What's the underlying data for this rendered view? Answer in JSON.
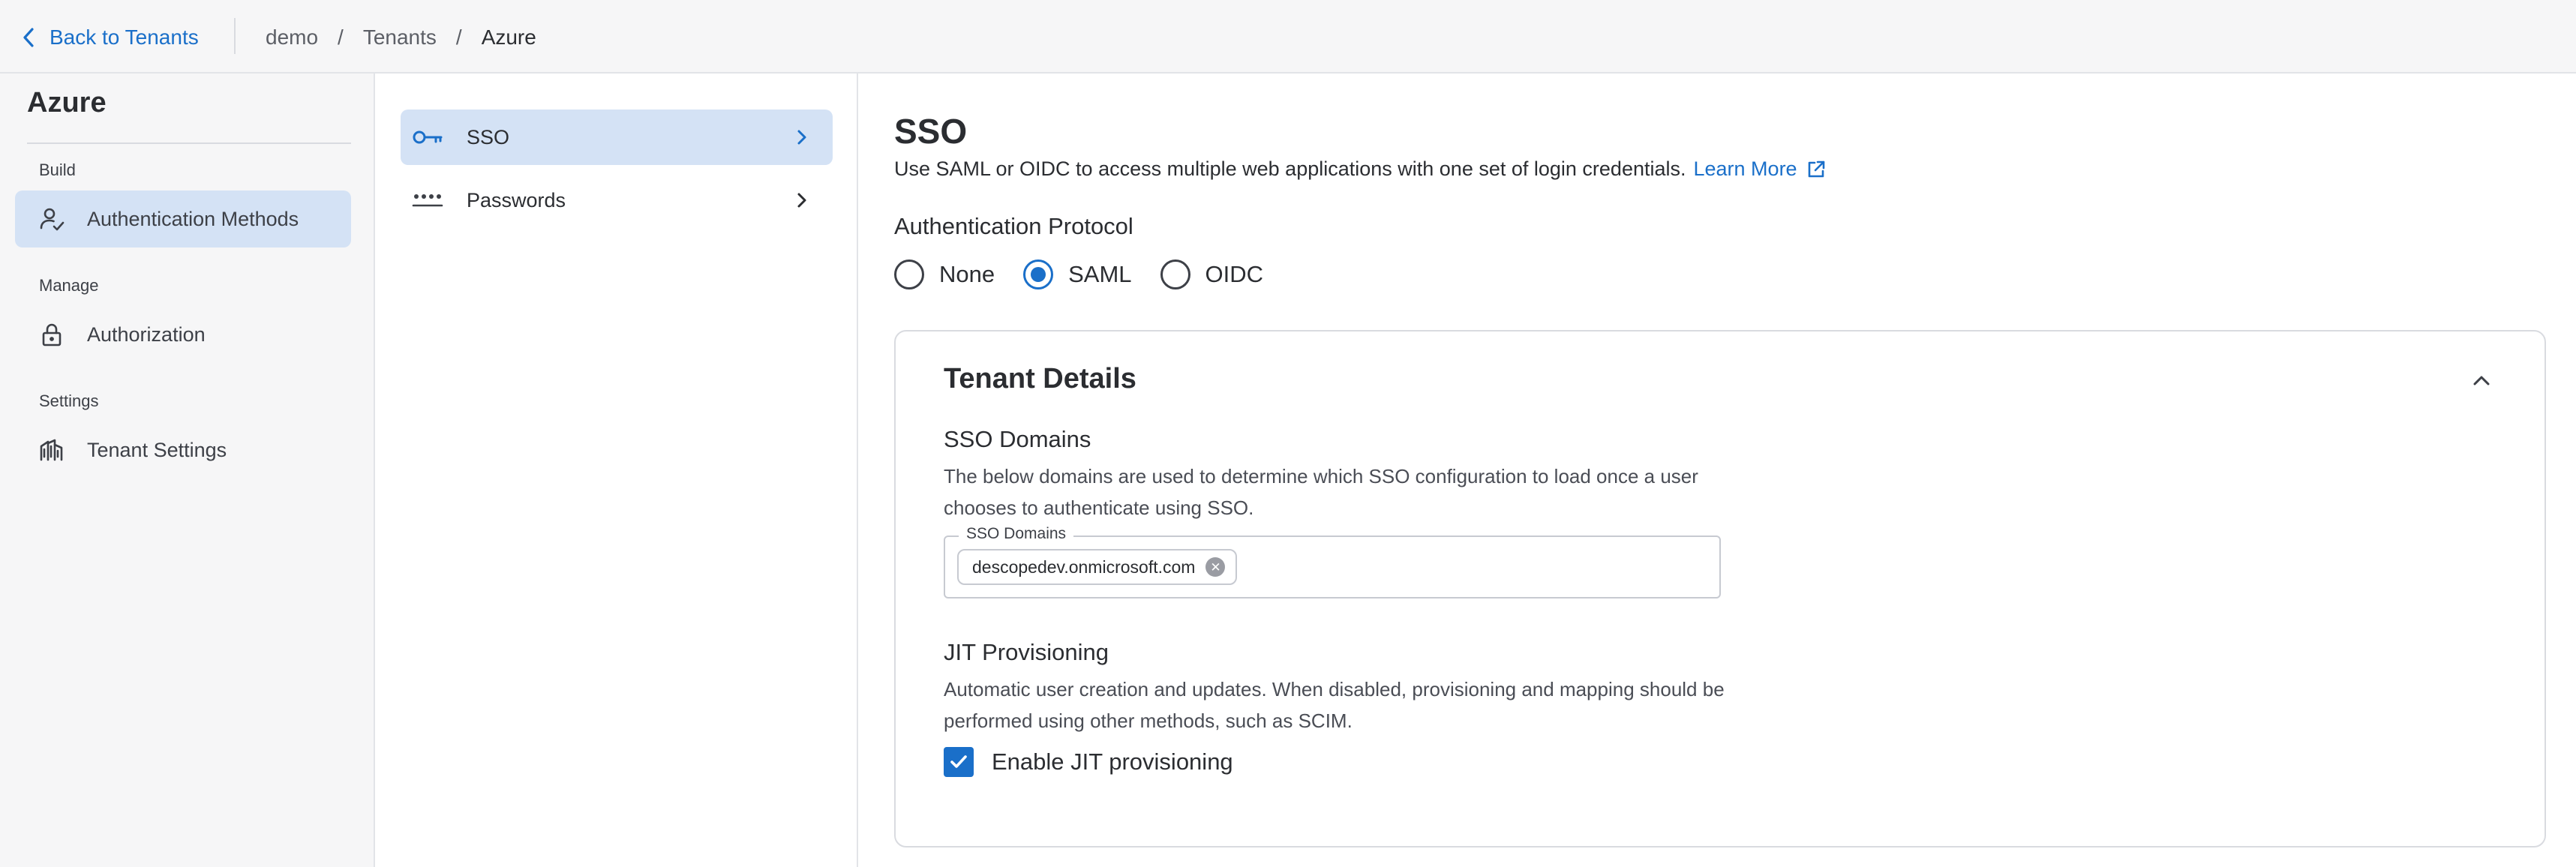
{
  "topbar": {
    "back_label": "Back to Tenants",
    "breadcrumb": [
      "demo",
      "Tenants",
      "Azure"
    ],
    "separator": "/"
  },
  "sidebar": {
    "tenant_name": "Azure",
    "sections": [
      {
        "label": "Build",
        "item": {
          "label": "Authentication Methods",
          "icon": "user-check-icon",
          "active": true
        }
      },
      {
        "label": "Manage",
        "item": {
          "label": "Authorization",
          "icon": "lock-icon",
          "active": false
        }
      },
      {
        "label": "Settings",
        "item": {
          "label": "Tenant Settings",
          "icon": "building-icon",
          "active": false
        }
      }
    ]
  },
  "methods": [
    {
      "label": "SSO",
      "icon": "key-icon",
      "active": true
    },
    {
      "label": "Passwords",
      "icon": "password-dots-icon",
      "active": false
    }
  ],
  "main": {
    "title": "SSO",
    "description": "Use SAML or OIDC to access multiple web applications with one set of login credentials.",
    "learn_more": "Learn More",
    "protocol_label": "Authentication Protocol",
    "protocol_options": [
      "None",
      "SAML",
      "OIDC"
    ],
    "protocol_selected": "SAML",
    "card": {
      "title": "Tenant Details",
      "sso_domains": {
        "title": "SSO Domains",
        "description": "The below domains are used to determine which SSO configuration to load once a user chooses to authenticate using SSO.",
        "field_label": "SSO Domains",
        "chips": [
          "descopedev.onmicrosoft.com"
        ]
      },
      "jit": {
        "title": "JIT Provisioning",
        "description": "Automatic user creation and updates. When disabled, provisioning and mapping should be performed using other methods, such as SCIM.",
        "checkbox_label": "Enable JIT provisioning",
        "checked": true
      }
    }
  },
  "colors": {
    "accent": "#1a6fc9",
    "active_bg": "#d4e2f5",
    "sidebar_bg": "#f6f6f7"
  }
}
